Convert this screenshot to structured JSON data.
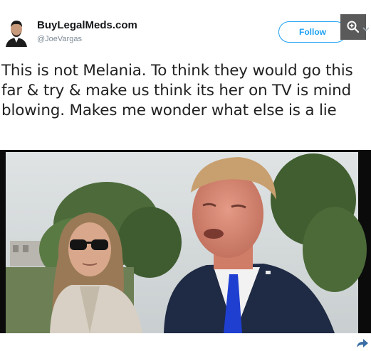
{
  "tweet": {
    "display_name": "BuyLegalMeds.com",
    "handle": "@JoeVargas",
    "follow_label": "Follow",
    "text": "This is not Melania. To think they would go this far & try & make us think its her on TV is mind blowing. Makes me wonder what else is a lie"
  },
  "icons": {
    "zoom": "zoom-in-icon",
    "chevron": "chevron-down-icon",
    "share": "share-icon"
  },
  "colors": {
    "accent": "#1da1f2",
    "text": "#222222",
    "handle": "#7d8a96"
  }
}
